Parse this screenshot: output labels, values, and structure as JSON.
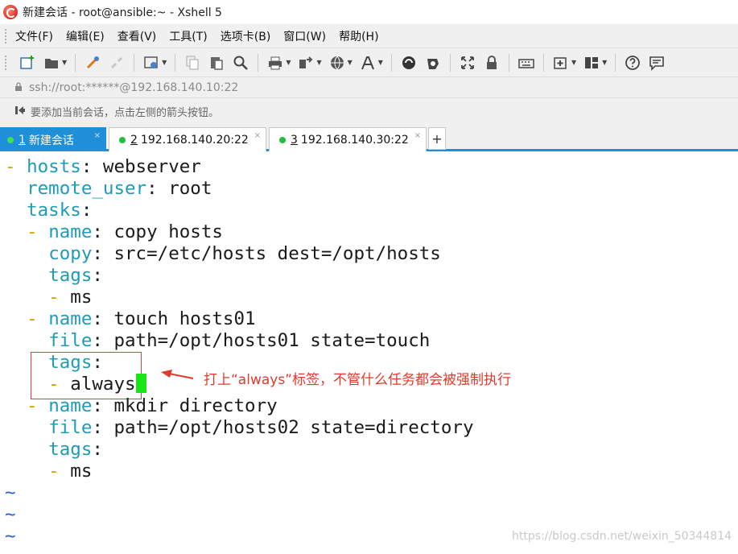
{
  "window": {
    "title": "新建会话 - root@ansible:~ - Xshell 5"
  },
  "menu": [
    "文件(F)",
    "编辑(E)",
    "查看(V)",
    "工具(T)",
    "选项卡(B)",
    "窗口(W)",
    "帮助(H)"
  ],
  "toolbar": {
    "icons": [
      "new-session-icon",
      "open-folder-icon",
      "connect-icon",
      "disconnect-icon",
      "properties-icon",
      "copy-icon",
      "paste-icon",
      "find-icon",
      "print-icon",
      "transfer-icon",
      "globe-icon",
      "font-icon",
      "xftp-icon",
      "xmanager-icon",
      "fullscreen-icon",
      "lock-icon",
      "keyboard-icon",
      "new-tab-icon",
      "layout-icon",
      "help-icon",
      "chat-icon"
    ]
  },
  "address": {
    "text": "ssh://root:******@192.168.140.10:22"
  },
  "hint": {
    "text": "要添加当前会话，点击左侧的箭头按钮。"
  },
  "tabs": [
    {
      "number": "1",
      "label": "新建会话",
      "active": true
    },
    {
      "number": "2",
      "label": "192.168.140.20:22",
      "active": false
    },
    {
      "number": "3",
      "label": "192.168.140.30:22",
      "active": false
    }
  ],
  "tab_close": "×",
  "tab_add": "+",
  "terminal": {
    "lines": [
      [
        {
          "t": "- ",
          "c": "d"
        },
        {
          "t": "hosts",
          "c": "k"
        },
        {
          "t": ": webserver",
          "c": ""
        }
      ],
      [
        {
          "t": "  ",
          "c": ""
        },
        {
          "t": "remote_user",
          "c": "k"
        },
        {
          "t": ": root",
          "c": ""
        }
      ],
      [
        {
          "t": "  ",
          "c": ""
        },
        {
          "t": "tasks",
          "c": "k"
        },
        {
          "t": ":",
          "c": ""
        }
      ],
      [
        {
          "t": "  - ",
          "c": "d"
        },
        {
          "t": "name",
          "c": "k"
        },
        {
          "t": ": copy hosts",
          "c": ""
        }
      ],
      [
        {
          "t": "    ",
          "c": ""
        },
        {
          "t": "copy",
          "c": "k"
        },
        {
          "t": ": src=/etc/hosts dest=/opt/hosts",
          "c": ""
        }
      ],
      [
        {
          "t": "    ",
          "c": ""
        },
        {
          "t": "tags",
          "c": "k"
        },
        {
          "t": ":",
          "c": ""
        }
      ],
      [
        {
          "t": "    - ",
          "c": "d"
        },
        {
          "t": "ms",
          "c": ""
        }
      ],
      [
        {
          "t": "  - ",
          "c": "d"
        },
        {
          "t": "name",
          "c": "k"
        },
        {
          "t": ": touch hosts01",
          "c": ""
        }
      ],
      [
        {
          "t": "    ",
          "c": ""
        },
        {
          "t": "file",
          "c": "k"
        },
        {
          "t": ": path=/opt/hosts01 state=touch",
          "c": ""
        }
      ],
      [
        {
          "t": "    ",
          "c": ""
        },
        {
          "t": "tags",
          "c": "k"
        },
        {
          "t": ":",
          "c": ""
        }
      ],
      [
        {
          "t": "    - ",
          "c": "d"
        },
        {
          "t": "always",
          "c": "",
          "cursor": true
        }
      ],
      [
        {
          "t": "  - ",
          "c": "d"
        },
        {
          "t": "name",
          "c": "k"
        },
        {
          "t": ": mkdir directory",
          "c": ""
        }
      ],
      [
        {
          "t": "    ",
          "c": ""
        },
        {
          "t": "file",
          "c": "k"
        },
        {
          "t": ": path=/opt/hosts02 state=directory",
          "c": ""
        }
      ],
      [
        {
          "t": "    ",
          "c": ""
        },
        {
          "t": "tags",
          "c": "k"
        },
        {
          "t": ":",
          "c": ""
        }
      ],
      [
        {
          "t": "    - ",
          "c": "d"
        },
        {
          "t": "ms",
          "c": ""
        }
      ],
      [
        {
          "t": "~",
          "c": "tilde"
        }
      ],
      [
        {
          "t": "~",
          "c": "tilde"
        }
      ],
      [
        {
          "t": "~",
          "c": "tilde"
        }
      ]
    ]
  },
  "annotation": {
    "text": "打上“always”标签，不管什么任务都会被强制执行",
    "color": "#e03a2a"
  },
  "watermark": {
    "text": "https://blog.csdn.net/weixin_50344814"
  },
  "colors": {
    "keyword": "#1e9bb8",
    "dash": "#c9a400",
    "tilde": "#2a60d6",
    "cursor": "#17e617",
    "tab_active": "#1e8fd8"
  }
}
